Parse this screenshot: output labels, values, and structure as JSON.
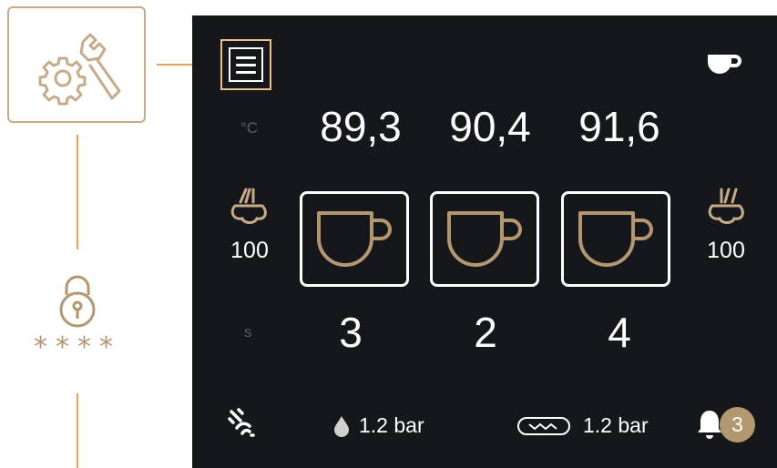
{
  "sidebar": {
    "pin_mask": "****"
  },
  "display": {
    "temp_unit": "°C",
    "time_unit": "s",
    "temperatures": [
      "89,3",
      "90,4",
      "91,6"
    ],
    "steam_left_value": "100",
    "steam_right_value": "100",
    "shot_counts": [
      "3",
      "2",
      "4"
    ]
  },
  "status_bar": {
    "water_pressure": "1.2 bar",
    "pump_pressure": "1.2 bar",
    "notification_count": "3"
  },
  "colors": {
    "accent_gold": "#b3976f",
    "connector_orange": "#e3a25a",
    "screen_bg": "#16171b",
    "text": "#ffffff"
  },
  "icons": [
    "tools-gear-wrench-icon",
    "lock-icon",
    "menu-icon",
    "cup-icon",
    "steam-wand-icon",
    "wifi-icon",
    "water-drop-icon",
    "pump-icon",
    "bell-icon"
  ]
}
